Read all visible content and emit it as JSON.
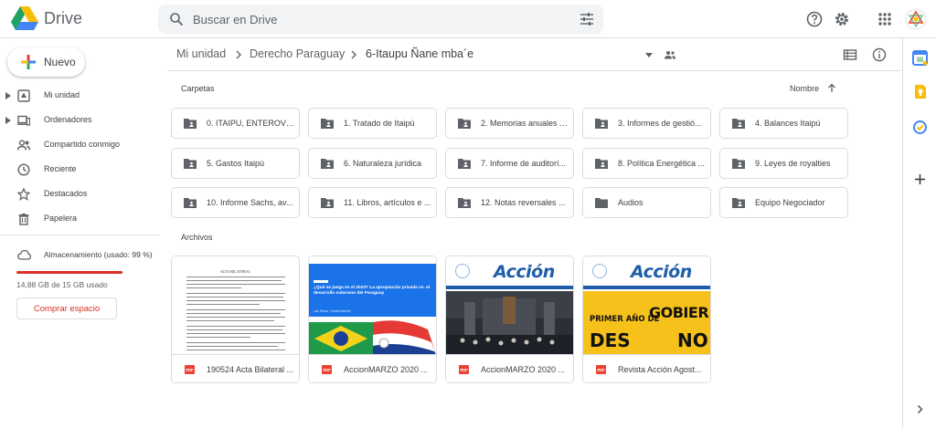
{
  "header": {
    "app_name": "Drive",
    "search_placeholder": "Buscar en Drive",
    "icons": [
      "google-drive-logo",
      "search-icon",
      "search-options-icon",
      "help-icon",
      "settings-icon",
      "apps-grid-icon",
      "account-avatar"
    ]
  },
  "sidebar": {
    "new_label": "Nuevo",
    "items": [
      {
        "label": "Mi unidad",
        "icon": "my-drive-icon",
        "expandable": true
      },
      {
        "label": "Ordenadores",
        "icon": "computers-icon",
        "expandable": true
      },
      {
        "label": "Compartido conmigo",
        "icon": "shared-icon",
        "expandable": false
      },
      {
        "label": "Reciente",
        "icon": "recent-clock-icon",
        "expandable": false
      },
      {
        "label": "Destacados",
        "icon": "star-icon",
        "expandable": false
      },
      {
        "label": "Papelera",
        "icon": "trash-icon",
        "expandable": false
      }
    ],
    "storage_label": "Almacenamiento (usado: 99 %)",
    "storage_percent": 99,
    "storage_used": "14,88 GB de 15 GB usado",
    "buy_label": "Comprar espacio"
  },
  "breadcrumb": {
    "items": [
      "Mi unidad",
      "Derecho Paraguay",
      "6-Itaupu Ñane mba´e"
    ]
  },
  "folders_label": "Carpetas",
  "sort_label": "Nombre",
  "folders": [
    "0. ITAIPU, ENTEROVE...",
    "1. Tratado de Itaipú",
    "2. Memorias anuales I...",
    "3. Informes de gestió...",
    "4. Balances Itaipú",
    "5. Gastos Itaipú",
    "6. Naturaleza jurídica",
    "7. Informe de auditorí...",
    "8. Política Energética ...",
    "9. Leyes de royalties",
    "10. Informe Sachs, av...",
    "11. Libros, artículos e ...",
    "12. Notas reversales ...",
    "Audios",
    "Equipo Negociador"
  ],
  "files_label": "Archivos",
  "files": [
    {
      "name": "190524 Acta Bilateral ...",
      "badge": "PDF",
      "thumb_title": "ACTA BILATERAL"
    },
    {
      "name": "AccionMARZO 2020 ...",
      "badge": "PDF",
      "thumb_headline": "¿Qué se juega en el 2023? La apropiación privada vs. el desarrollo soberano del Paraguay",
      "thumb_author": "Luis Rocha + Andrés Bernini"
    },
    {
      "name": "AccionMARZO 2020 ...",
      "badge": "PDF",
      "thumb_masthead": "Acción"
    },
    {
      "name": "Revista Acción Agost...",
      "badge": "PDF",
      "thumb_masthead": "Acción",
      "thumb_words": [
        "PRIMER AÑO DE",
        "GOBIER",
        "DES",
        "NO"
      ]
    }
  ],
  "colors": {
    "accent": "#1a73e8",
    "storage_warning": "#d93025",
    "pdf_red": "#ea4335",
    "folder_icon": "#5f6368"
  }
}
